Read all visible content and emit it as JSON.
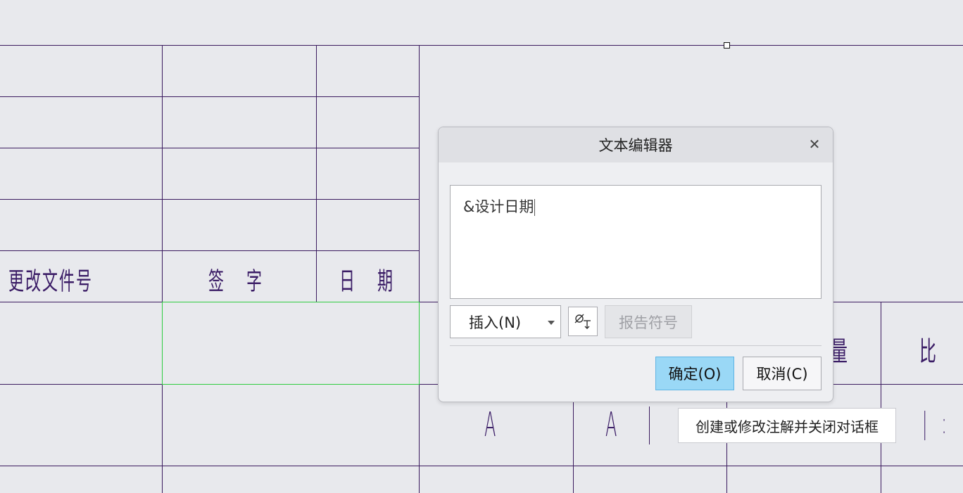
{
  "drawing": {
    "headers": {
      "change_doc_no": "更改文件号",
      "signature": "签  字",
      "date": "日  期"
    },
    "right_labels": {
      "weight_partial": "量",
      "ratio": "比",
      "size_a1": "A",
      "size_a2": "A",
      "scale_partial": "|  :"
    },
    "colors": {
      "line": "#3a1a5e",
      "selection": "#2ecc40",
      "background": "#e8e9ed"
    }
  },
  "dialog": {
    "title": "文本编辑器",
    "close_icon": "close-icon",
    "text_value": "&设计日期",
    "insert_label": "插入(N)",
    "symbol_icon": "text-symbol-icon",
    "report_symbol_label": "报告符号",
    "ok_label": "确定(O)",
    "cancel_label": "取消(C)"
  },
  "tooltip": {
    "text": "创建或修改注解并关闭对话框"
  }
}
